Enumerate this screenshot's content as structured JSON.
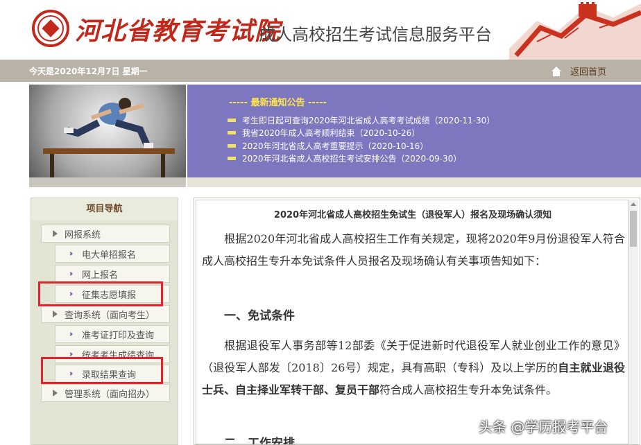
{
  "header": {
    "logo_text": "河北省教育考试院",
    "site_title": "成人高校招生考试信息服务平台"
  },
  "topbar": {
    "date": "今天是2020年12月7日 星期一",
    "home_label": "返回首页"
  },
  "notice": {
    "title": "----- 最新通知公告 -----",
    "items": [
      "考生即日起可查询2020年河北省成人高考考试成绩（2020-11-30）",
      "我省2020年成人高考顺利结束（2020-10-26）",
      "2020年河北省成人高考重要提示（2020-10-16）",
      "2020年河北省成人高校招生考试安排公告（2020-09-30）"
    ]
  },
  "sidebar": {
    "title": "项目导航",
    "items": [
      {
        "label": "网报系统",
        "type": "group"
      },
      {
        "label": "电大单招报名",
        "type": "sub"
      },
      {
        "label": "网上报名",
        "type": "sub"
      },
      {
        "label": "征集志愿填报",
        "type": "sub"
      },
      {
        "label": "查询系统（面向考生）",
        "type": "group"
      },
      {
        "label": "准考证打印及查询",
        "type": "sub"
      },
      {
        "label": "统考考生成绩查询",
        "type": "sub"
      },
      {
        "label": "录取结果查询",
        "type": "sub"
      },
      {
        "label": "管理系统（面向招办）",
        "type": "group"
      }
    ]
  },
  "article": {
    "title": "2020年河北省成人高校招生免试生（退役军人）报名及现场确认须知",
    "intro": "根据2020年河北省成人高校招生工作有关规定，现将2020年9月份退役军人符合成人高校招生专升本免试条件人员报名及现场确认有关事项告知如下：",
    "section1": "一、免试条件",
    "p2_pre": "根据退役军人事务部等12部委《关于促进新时代退役军人就业创业工作的意见》（退役军人部发〔2018〕26号）规定，具有高职（专科）及以上学历的",
    "p2_bold": "自主就业退役士兵、自主择业军转干部、复员干部",
    "p2_post": "符合成人高校招生专升本免试条件。",
    "section2": "二、工作安排"
  },
  "watermark": "头条 @学历报考平台",
  "colors": {
    "brand_red": "#c0281c",
    "notice_bg": "#7d77bf",
    "notice_title": "#ffe54a",
    "highlight_box": "#e5212b"
  }
}
